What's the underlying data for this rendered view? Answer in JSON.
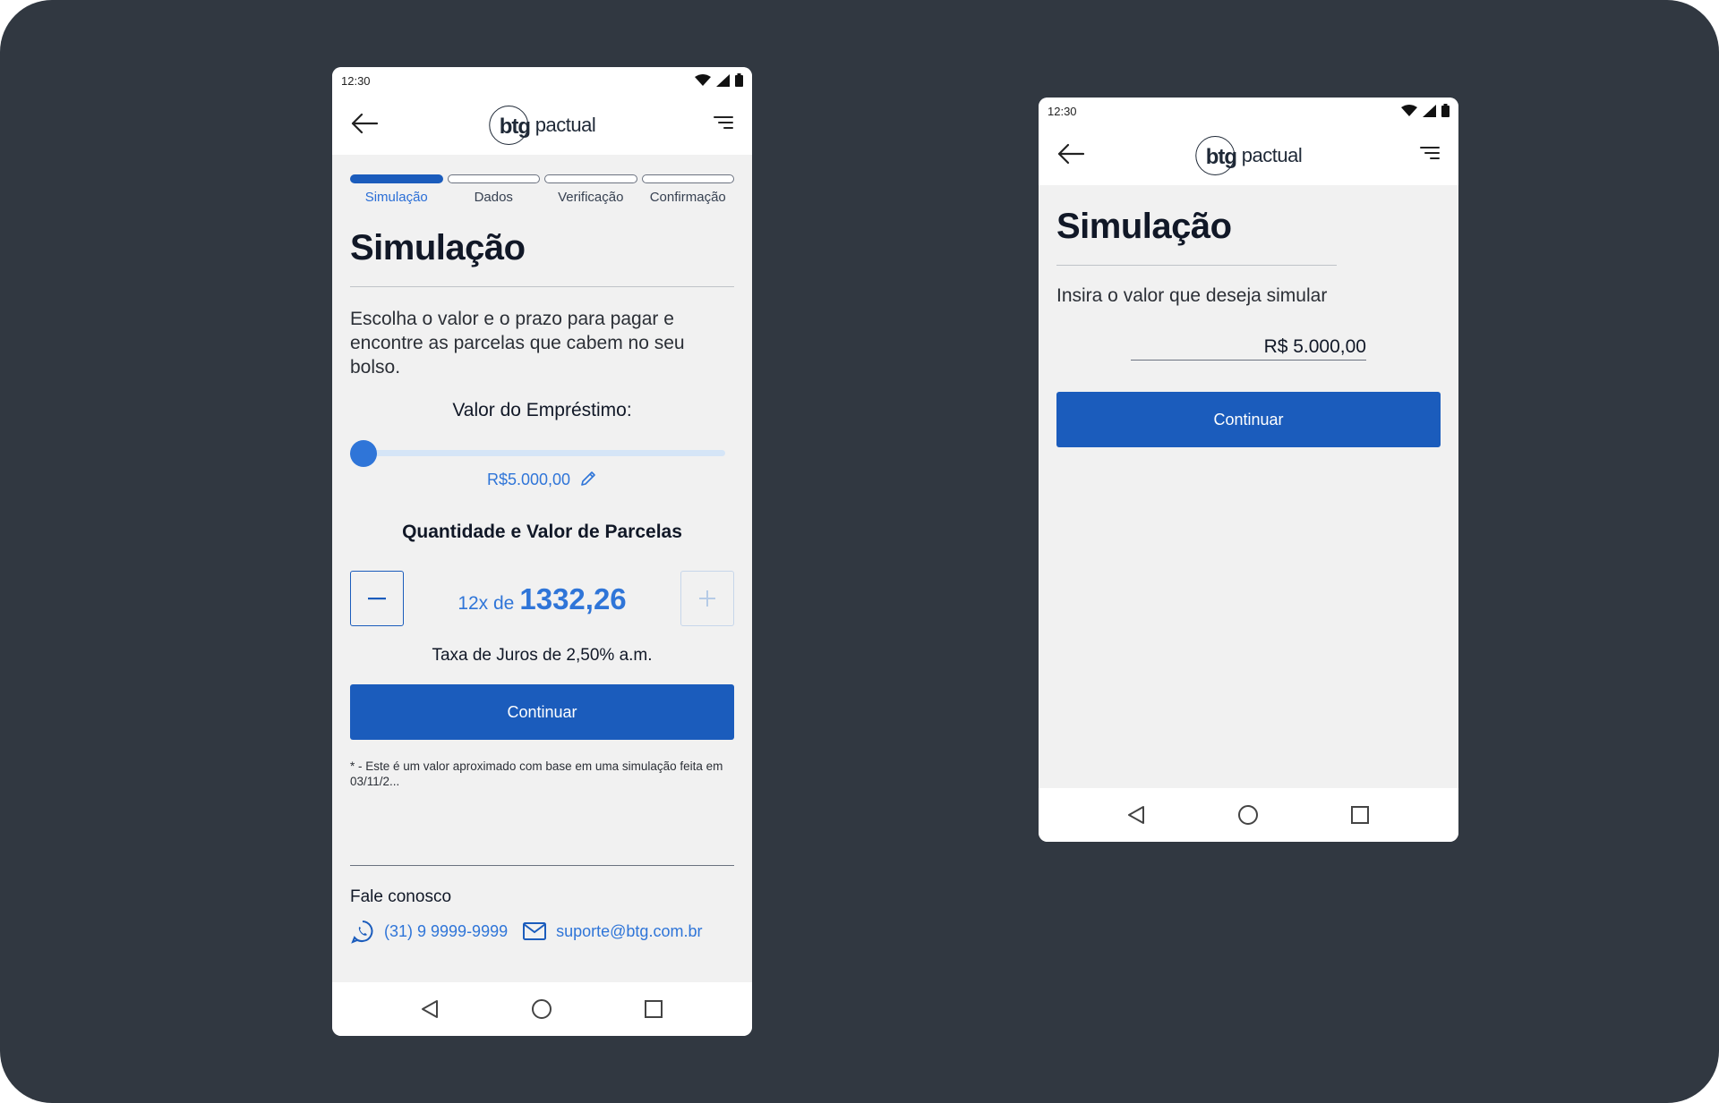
{
  "status_bar": {
    "time": "12:30"
  },
  "brand": {
    "logo_bold": "btg",
    "logo_light": "pactual",
    "accent_color": "#1b5cbc"
  },
  "left_screen": {
    "steps": [
      {
        "label": "Simulação",
        "active": true
      },
      {
        "label": "Dados",
        "active": false
      },
      {
        "label": "Verificação",
        "active": false
      },
      {
        "label": "Confirmação",
        "active": false
      }
    ],
    "title": "Simulação",
    "description": "Escolha o valor e o prazo para pagar e encontre as parcelas que cabem no seu bolso.",
    "loan_label": "Valor do Empréstimo:",
    "loan_value": "R$5.000,00",
    "slider_level": 0,
    "installments_label": "Quantidade e Valor de Parcelas",
    "installment_count": "12x de",
    "installment_amount": "1332,26",
    "interest_rate": "Taxa de Juros de 2,50% a.m.",
    "continue_label": "Continuar",
    "disclaimer": "* - Este é um valor aproximado com base em uma simulação feita em 03/11/2...",
    "contact": {
      "title": "Fale conosco",
      "phone": "(31) 9 9999-9999",
      "email": "suporte@btg.com.br"
    }
  },
  "right_screen": {
    "title": "Simulação",
    "prompt": "Insira o valor que deseja simular",
    "amount_value": "R$ 5.000,00",
    "continue_label": "Continuar"
  },
  "icons": {
    "back": "arrow-left-icon",
    "menu": "menu-icon",
    "wifi": "wifi-icon",
    "signal": "signal-icon",
    "battery": "battery-icon",
    "edit": "pencil-icon",
    "whatsapp": "whatsapp-icon",
    "mail": "mail-icon",
    "nav_back": "triangle-back-icon",
    "nav_home": "circle-home-icon",
    "nav_recent": "square-recent-icon"
  }
}
